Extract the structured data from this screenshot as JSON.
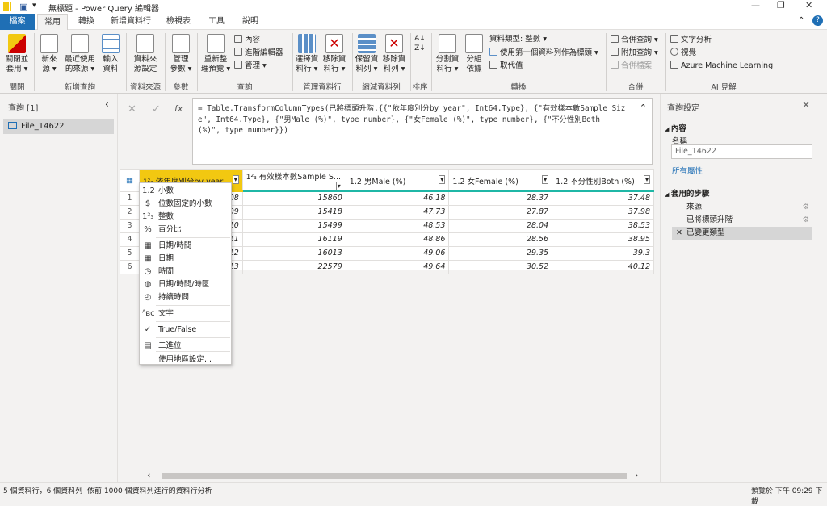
{
  "title": "無標題 - Power Query 編輯器",
  "tabs": [
    "檔案",
    "常用",
    "轉換",
    "新增資料行",
    "檢視表",
    "工具",
    "說明"
  ],
  "ribbon": {
    "close_apply": "關閉並\n套用 ▾",
    "new_source": "新來\n源 ▾",
    "recent_sources": "最近使用\n的來源 ▾",
    "enter_data": "輸入\n資料",
    "data_source_settings": "資料來\n源設定",
    "manage_params": "管理\n參數 ▾",
    "refresh_preview": "重新整\n理預覽 ▾",
    "properties": "內容",
    "advanced_editor": "進階編輯器",
    "manage": "管理 ▾",
    "choose_columns": "選擇資\n料行 ▾",
    "remove_columns": "移除資\n料行 ▾",
    "keep_rows": "保留資\n料列 ▾",
    "remove_rows": "移除資\n料列 ▾",
    "split_column": "分割資\n料行 ▾",
    "group_by": "分組\n依據",
    "data_type": "資料類型: 整數 ▾",
    "first_row_header": "使用第一個資料列作為標頭 ▾",
    "replace_values": "取代值",
    "merge_queries": "合併查詢 ▾",
    "append_queries": "附加查詢 ▾",
    "combine_files": "合併檔案",
    "text_analytics": "文字分析",
    "vision": "視覺",
    "azure_ml": "Azure Machine Learning",
    "groups": {
      "close": "關閉",
      "new_query": "新增查詢",
      "data_sources": "資料來源",
      "params": "參數",
      "query": "查詢",
      "manage_columns": "管理資料行",
      "reduce_rows": "縮減資料列",
      "sort": "排序",
      "transform": "轉換",
      "combine": "合併",
      "ai": "AI 見解"
    }
  },
  "queries": {
    "header": "查詢 [1]",
    "items": [
      "File_14622"
    ]
  },
  "formula": {
    "text": "= Table.TransformColumnTypes(已將標頭升階,{{\"依年度別分by year\", Int64.Type}, {\"有效樣本數Sample Size\", Int64.Type}, {\"男Male (%)\", type number}, {\"女Female (%)\", type number}, {\"不分性別Both (%)\", type number}})"
  },
  "grid": {
    "columns": [
      {
        "type": "1²₃",
        "name": "依年度別分by year"
      },
      {
        "type": "1²₃",
        "name": "有效樣本數Sample S..."
      },
      {
        "type": "1.2",
        "name": "男Male (%)"
      },
      {
        "type": "1.2",
        "name": "女Female (%)"
      },
      {
        "type": "1.2",
        "name": "不分性別Both (%)"
      }
    ],
    "rows": [
      [
        "1",
        "08",
        "15860",
        "46.18",
        "28.37",
        "37.48"
      ],
      [
        "2",
        "09",
        "15418",
        "47.73",
        "27.87",
        "37.98"
      ],
      [
        "3",
        "10",
        "15499",
        "48.53",
        "28.04",
        "38.53"
      ],
      [
        "4",
        "11",
        "16119",
        "48.86",
        "28.56",
        "38.95"
      ],
      [
        "5",
        "12",
        "16013",
        "49.06",
        "29.35",
        "39.3"
      ],
      [
        "6",
        "13",
        "22579",
        "49.64",
        "30.52",
        "40.12"
      ]
    ]
  },
  "type_menu": [
    "小數",
    "位數固定的小數",
    "整數",
    "百分比",
    "日期/時間",
    "日期",
    "時間",
    "日期/時間/時區",
    "持續時間",
    "文字",
    "True/False",
    "二進位",
    "使用地區設定..."
  ],
  "type_icons": [
    "1.2",
    "$",
    "1²₃",
    "%",
    "▦",
    "▦",
    "◷",
    "◍",
    "◴",
    "ᴬʙc",
    "✓",
    "▤",
    ""
  ],
  "settings": {
    "header": "查詢設定",
    "props_section": "內容",
    "name_label": "名稱",
    "name_value": "File_14622",
    "all_props": "所有屬性",
    "steps_section": "套用的步驟",
    "steps": [
      "來源",
      "已將標頭升階",
      "已變更類型"
    ]
  },
  "status": {
    "left": "5 個資料行，6 個資料列",
    "mid": "依前 1000 個資料列進行的資料行分析",
    "right": "預覽於 下午 09:29 下載"
  }
}
